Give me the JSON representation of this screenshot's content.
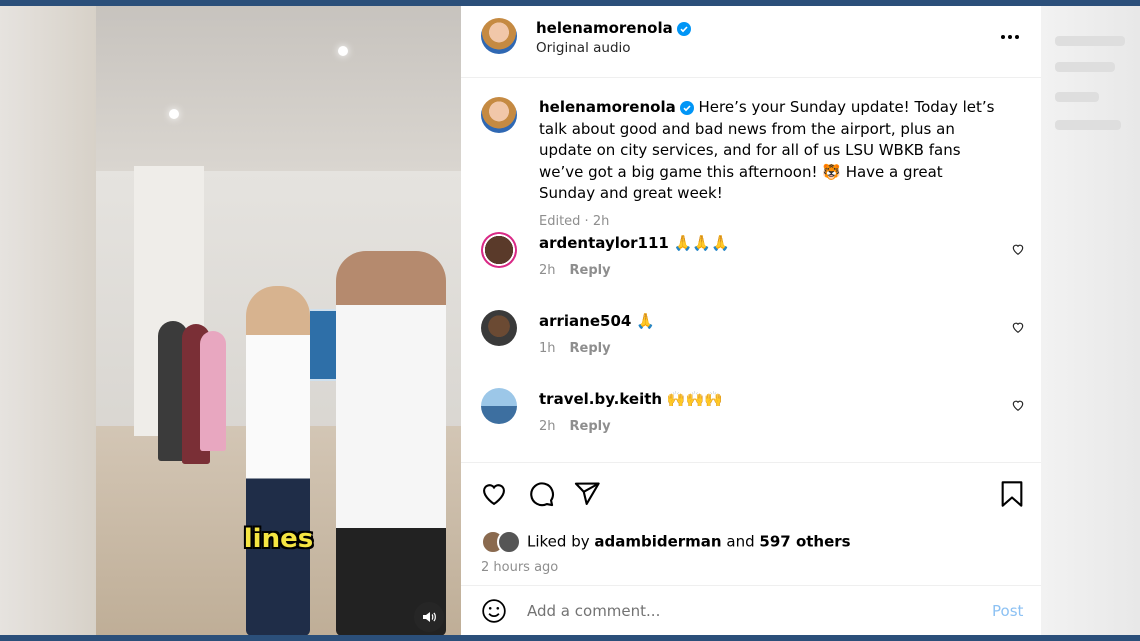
{
  "post": {
    "author": "helenamorenola",
    "audio": "Original audio",
    "caption": "Here’s your Sunday update! Today let’s talk about good and bad news from the airport, plus an update on city services, and for all of us LSU WBKB fans we’ve got a big game this afternoon! 🐯 Have a great Sunday and great week!",
    "caption_meta": "Edited · 2h"
  },
  "video": {
    "subtitle": "lines"
  },
  "comments": [
    {
      "user": "ardentaylor111",
      "text": "🙏🙏🙏",
      "time": "2h",
      "reply": "Reply"
    },
    {
      "user": "arriane504",
      "text": "🙏",
      "time": "1h",
      "reply": "Reply"
    },
    {
      "user": "travel.by.keith",
      "text": "🙌🙌🙌",
      "time": "2h",
      "reply": "Reply"
    }
  ],
  "likes": {
    "prefix": "Liked by",
    "user": "adambiderman",
    "joiner": "and",
    "others": "597 others"
  },
  "post_time": "2 hours ago",
  "comment_box": {
    "placeholder": "Add a comment...",
    "post_label": "Post"
  },
  "colors": {
    "verified": "#0095f6",
    "post_disabled": "#8cc1f3",
    "frame": "#2b4f7a"
  },
  "icons": [
    "verified-badge-icon",
    "more-options-icon",
    "heart-icon",
    "comment-icon",
    "share-icon",
    "bookmark-icon",
    "emoji-icon",
    "volume-icon"
  ]
}
